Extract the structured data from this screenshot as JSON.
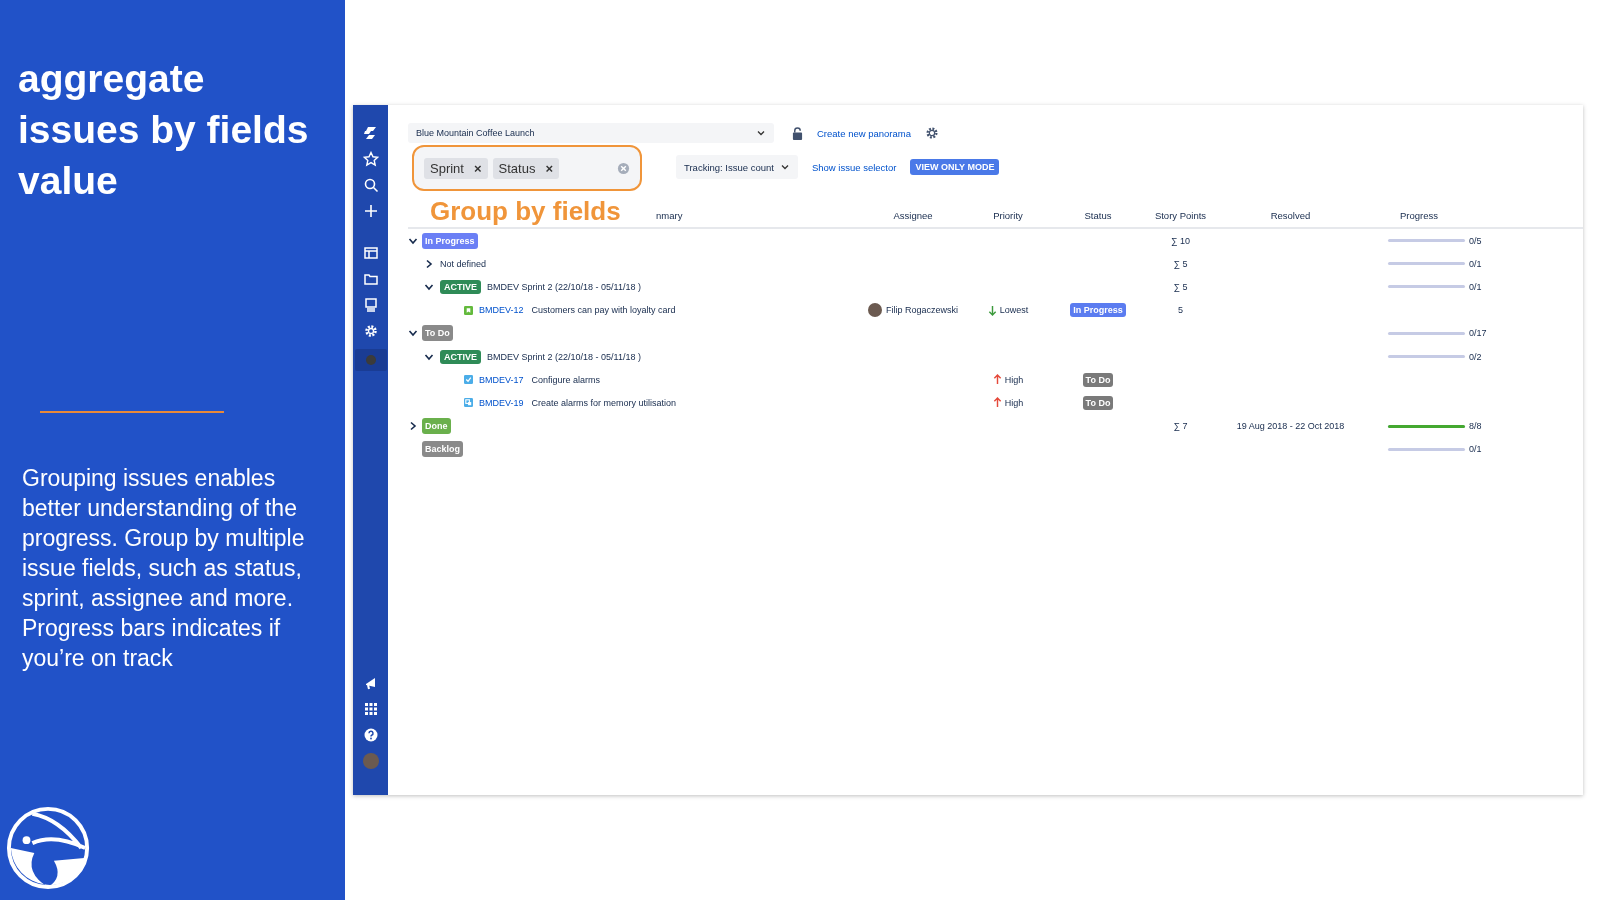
{
  "slide": {
    "heading": "aggregate issues by fields value",
    "body": "Grouping issues enables better understanding of the progress. Group by multiple issue fields, such as status, sprint, assignee and more. Progress bars indicates if you’re on track"
  },
  "app": {
    "project_select": "Blue Mountain Coffee Launch",
    "create_link": "Create new panorama",
    "tracking_select": "Tracking: Issue count",
    "selector_link": "Show issue selector",
    "mode_button": "VIEW ONLY MODE",
    "group_by": {
      "chips": [
        "Sprint",
        "Status"
      ],
      "chip_remove": "×",
      "caption": "Group by fields"
    },
    "columns": [
      "nmary",
      "Assignee",
      "Priority",
      "Status",
      "Story Points",
      "Resolved",
      "Progress"
    ],
    "rows": [
      {
        "kind": "status",
        "label": "In Progress",
        "color": "#6b7ff5",
        "expanded": true,
        "points": "∑ 10",
        "progress": {
          "level": 0,
          "label": "0/5"
        },
        "children": [
          {
            "kind": "value",
            "label": "Not defined",
            "expanded": false,
            "points": "∑ 5",
            "progress": {
              "level": 0,
              "label": "0/1"
            }
          },
          {
            "kind": "sprint",
            "tag": "ACTIVE",
            "label": "BMDEV Sprint 2 (22/10/18 - 05/11/18 )",
            "expanded": true,
            "points": "∑ 5",
            "progress": {
              "level": 0,
              "label": "0/1"
            },
            "children": [
              {
                "kind": "story",
                "key": "BMDEV-12",
                "summary": "Customers can pay with loyalty card",
                "assignee": "Filip Rogaczewski",
                "priority": {
                  "kind": "down",
                  "label": "Lowest"
                },
                "status": {
                  "label": "In Progress",
                  "color": "#5b7cf0"
                },
                "points": "5"
              }
            ]
          }
        ]
      },
      {
        "kind": "status",
        "label": "To Do",
        "color": "#8a8a8a",
        "expanded": true,
        "progress": {
          "level": 0,
          "label": "0/17"
        },
        "children": [
          {
            "kind": "sprint",
            "tag": "ACTIVE",
            "label": "BMDEV Sprint 2 (22/10/18 - 05/11/18 )",
            "expanded": true,
            "progress": {
              "level": 0,
              "label": "0/2"
            },
            "children": [
              {
                "kind": "task",
                "key": "BMDEV-17",
                "summary": "Configure alarms",
                "priority": {
                  "kind": "up",
                  "label": "High"
                },
                "status": {
                  "label": "To Do",
                  "color": "#7a7a7a"
                }
              },
              {
                "kind": "subtask",
                "key": "BMDEV-19",
                "summary": "Create alarms for memory utilisation",
                "priority": {
                  "kind": "up",
                  "label": "High"
                },
                "status": {
                  "label": "To Do",
                  "color": "#7a7a7a"
                }
              }
            ]
          }
        ]
      },
      {
        "kind": "status",
        "label": "Done",
        "color": "#6ab04c",
        "expanded": false,
        "points": "∑ 7",
        "resolved": "19 Aug 2018 - 22 Oct 2018",
        "progress": {
          "level": 1,
          "label": "8/8"
        }
      },
      {
        "kind": "status",
        "label": "Backlog",
        "color": "#8a8a8a",
        "progress": {
          "level": 0,
          "label": "0/1"
        }
      }
    ]
  }
}
